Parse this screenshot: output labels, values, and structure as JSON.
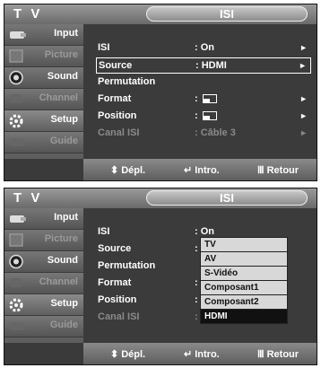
{
  "screens": [
    {
      "tv_label": "T V",
      "title": "ISI",
      "sidebar": [
        {
          "label": "Input",
          "icon": "input-icon"
        },
        {
          "label": "Picture",
          "icon": "picture-icon"
        },
        {
          "label": "Sound",
          "icon": "sound-icon"
        },
        {
          "label": "Channel",
          "icon": "channel-icon"
        },
        {
          "label": "Setup",
          "icon": "setup-icon"
        },
        {
          "label": "Guide",
          "icon": "guide-icon"
        }
      ],
      "rows": [
        {
          "label": "ISI",
          "value": ": On",
          "arrow": "►"
        },
        {
          "label": "Source",
          "value": ": HDMI",
          "arrow": "►"
        },
        {
          "label": "Permutation",
          "value": "",
          "arrow": ""
        },
        {
          "label": "Format",
          "value": ":",
          "arrow": "►"
        },
        {
          "label": "Position",
          "value": ":",
          "arrow": "►"
        },
        {
          "label": "Canal ISI",
          "value": ": Câble 3",
          "arrow": "►"
        }
      ],
      "footer": {
        "move": "Dépl.",
        "enter": "Intro.",
        "return": "Retour",
        "move_glyph": "⬍",
        "enter_glyph": "↵",
        "return_glyph": "Ⅲ"
      }
    },
    {
      "tv_label": "T V",
      "title": "ISI",
      "sidebar": [
        {
          "label": "Input",
          "icon": "input-icon"
        },
        {
          "label": "Picture",
          "icon": "picture-icon"
        },
        {
          "label": "Sound",
          "icon": "sound-icon"
        },
        {
          "label": "Channel",
          "icon": "channel-icon"
        },
        {
          "label": "Setup",
          "icon": "setup-icon"
        },
        {
          "label": "Guide",
          "icon": "guide-icon"
        }
      ],
      "rows": [
        {
          "label": "ISI",
          "value": ": On"
        },
        {
          "label": "Source",
          "value": ":"
        },
        {
          "label": "Permutation",
          "value": ""
        },
        {
          "label": "Format",
          "value": ":"
        },
        {
          "label": "Position",
          "value": ":"
        },
        {
          "label": "Canal ISI",
          "value": ":"
        }
      ],
      "source_options": [
        "TV",
        "AV",
        "S-Vidéo",
        "Composant1",
        "Composant2",
        "HDMI"
      ],
      "selected_option": "HDMI",
      "footer": {
        "move": "Dépl.",
        "enter": "Intro.",
        "return": "Retour",
        "move_glyph": "⬍",
        "enter_glyph": "↵",
        "return_glyph": "Ⅲ"
      }
    }
  ],
  "colors": {
    "background": "#3b3b3b",
    "highlight": "#ffffff",
    "selected_option_bg": "#111111"
  }
}
